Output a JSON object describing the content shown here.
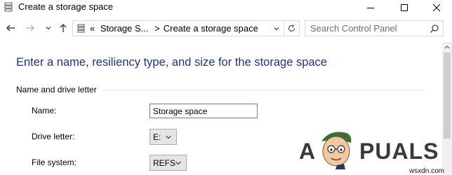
{
  "window": {
    "title": "Create a storage space",
    "controls": {
      "minimize_icon": "minimize-icon",
      "maximize_icon": "maximize-icon",
      "close_icon": "close-icon"
    }
  },
  "navigation": {
    "back_icon": "arrow-left-icon",
    "forward_icon": "arrow-right-icon",
    "recent_icon": "chevron-down-icon",
    "up_icon": "arrow-up-icon",
    "address": {
      "overflow": "«",
      "crumbs": [
        "Storage S...",
        "Create a storage space"
      ],
      "separator": ">"
    },
    "refresh_icon": "refresh-icon",
    "search": {
      "placeholder": "Search Control Panel",
      "value": ""
    }
  },
  "main": {
    "heading": "Enter a name, resiliency type, and size for the storage space",
    "section_title": "Name and drive letter",
    "fields": {
      "name_label": "Name:",
      "name_value": "Storage space",
      "drive_label": "Drive letter:",
      "drive_value": "E:",
      "fs_label": "File system:",
      "fs_value": "REFS"
    }
  },
  "watermark": {
    "text_a": "A",
    "text_rest": "PUALS",
    "site": "wsxdn.com"
  },
  "colors": {
    "heading": "#1e3287",
    "border": "#d9d9d9",
    "select_bg": "#e5e5e5",
    "scroll_thumb": "#cdcdcd"
  }
}
